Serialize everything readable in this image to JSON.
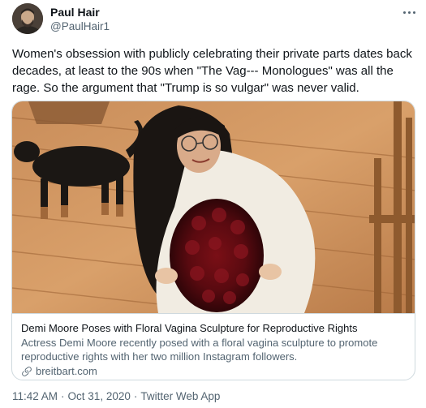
{
  "author": {
    "name": "Paul Hair",
    "handle": "@PaulHair1"
  },
  "tweet": {
    "text": "Women's obsession with publicly celebrating their private parts dates back decades, at least to the 90s when \"The Vag--- Monologues\" was all the rage. So the argument that \"Trump is so vulgar\" was never valid."
  },
  "card": {
    "title": "Demi Moore Poses with Floral Vagina Sculpture for Reproductive Rights",
    "description": "Actress Demi Moore recently posed with a floral vagina sculpture to promote reproductive rights with her two million Instagram followers.",
    "domain": "breitbart.com"
  },
  "meta": {
    "time": "11:42 AM",
    "separator1": "·",
    "date": "Oct 31, 2020",
    "separator2": "·",
    "source": "Twitter Web App"
  },
  "icons": {
    "more": "more-horizontal-icon",
    "link": "link-icon"
  },
  "colors": {
    "text": "#0f1419",
    "secondary": "#536471",
    "border": "#cfd9de"
  }
}
